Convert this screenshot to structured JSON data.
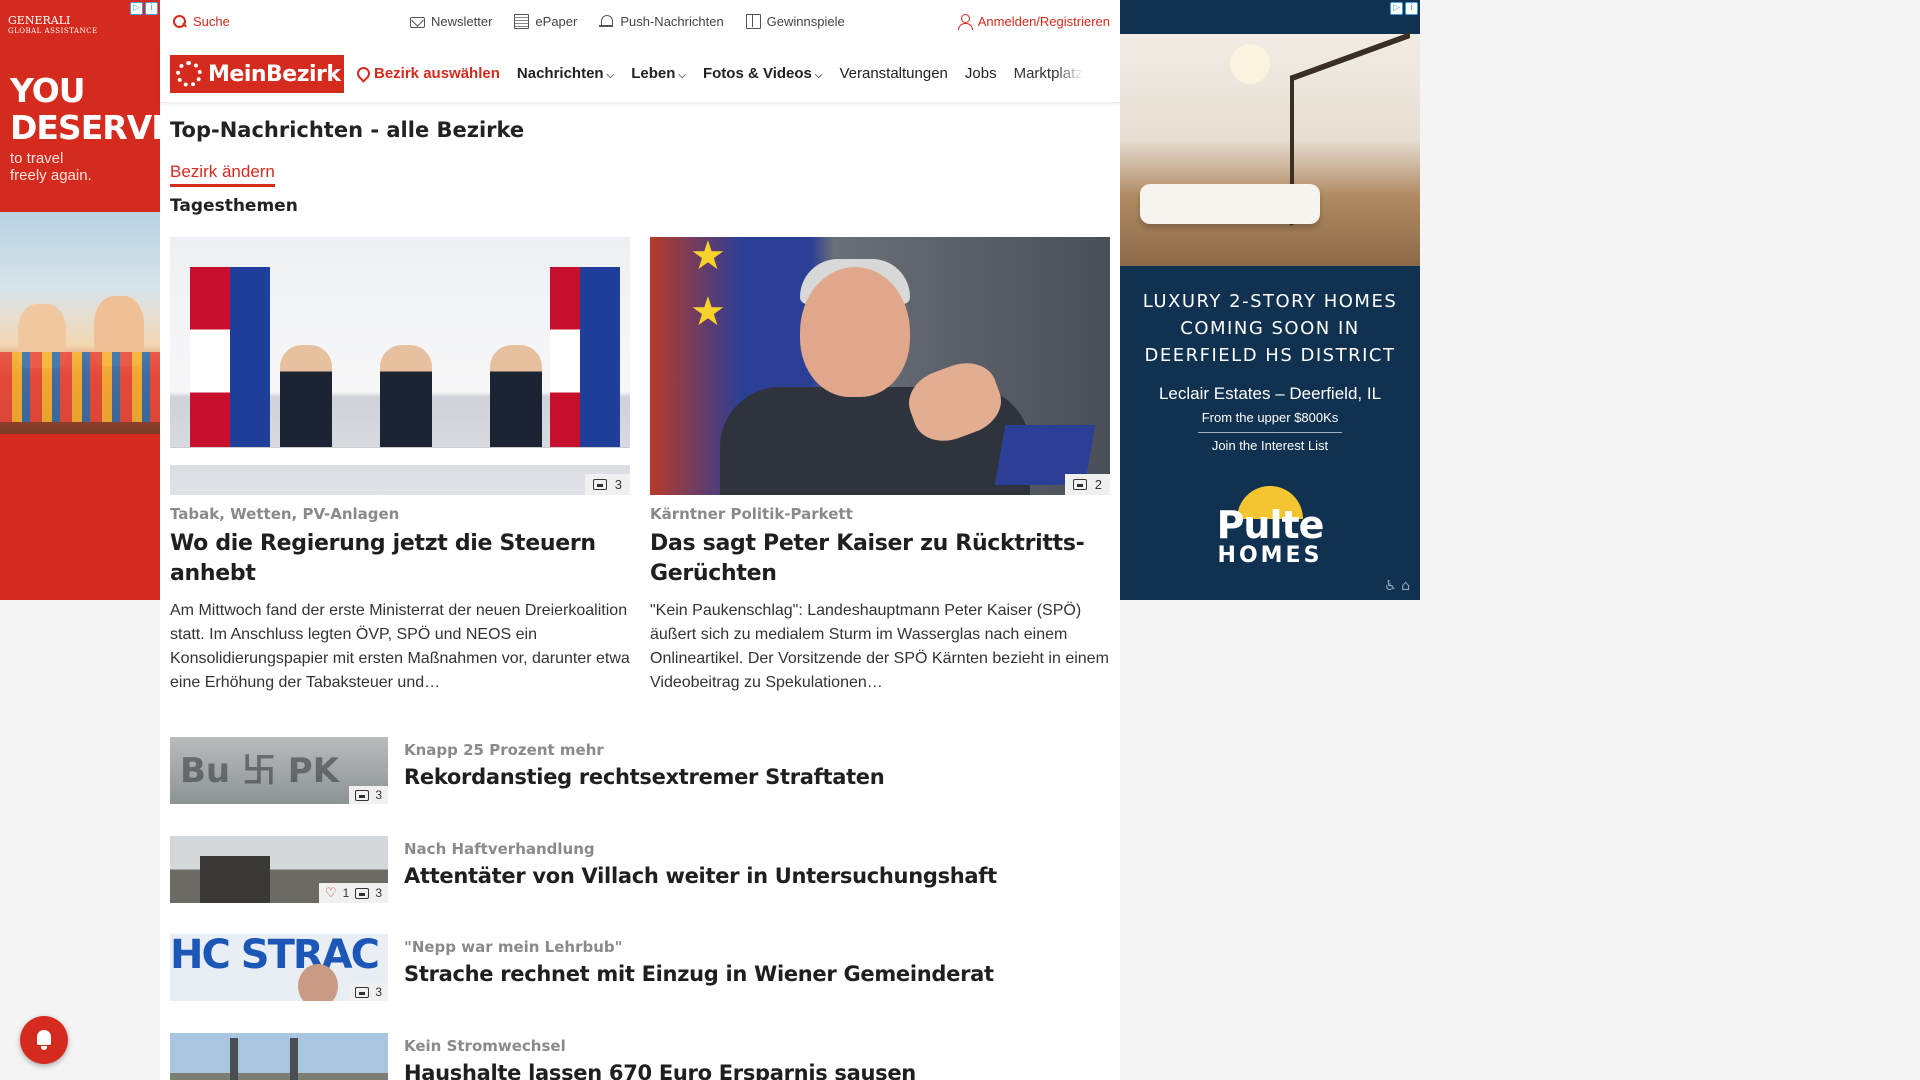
{
  "ads": {
    "left": {
      "brand": "GENERALI",
      "brand_sub": "GLOBAL ASSISTANCE",
      "headline_line1": "YOU",
      "headline_line2": "DESERVE",
      "sub_line1": "to travel",
      "sub_line2": "freely again."
    },
    "right": {
      "headline_line1": "LUXURY 2-STORY HOMES",
      "headline_line2": "COMING SOON IN",
      "headline_line3": "DEERFIELD HS DISTRICT",
      "community": "Leclair Estates – Deerfield, IL",
      "price": "From the upper $800Ks",
      "cta": "Join the Interest List",
      "logo_word1": "Pulte",
      "logo_word2": "HOMES"
    }
  },
  "utility": {
    "search": "Suche",
    "newsletter": "Newsletter",
    "epaper": "ePaper",
    "push": "Push-Nachrichten",
    "gewinnspiele": "Gewinnspiele",
    "login": "Anmelden/Registrieren"
  },
  "nav": {
    "logo": "MeinBezirk",
    "region": "Bezirk auswählen",
    "items": [
      "Nachrichten",
      "Leben",
      "Fotos & Videos",
      "Veranstaltungen",
      "Jobs",
      "Marktplatz"
    ]
  },
  "page": {
    "title": "Top-Nachrichten - alle Bezirke",
    "change_district": "Bezirk ändern",
    "section": "Tagesthemen"
  },
  "featured": [
    {
      "kicker": "Tabak, Wetten, PV-Anlagen",
      "headline": "Wo die Regierung jetzt die Steuern anhebt",
      "teaser": "Am Mittwoch fand der erste Ministerrat der neuen Dreierkoalition statt. Im Anschluss legten ÖVP, SPÖ und NEOS ein Konsolidierungspapier mit ersten Maßnahmen vor, darunter etwa eine Erhöhung der Tabaksteuer und…",
      "photos": "3"
    },
    {
      "kicker": "Kärntner Politik-Parkett",
      "headline": "Das sagt Peter Kaiser zu Rücktritts-Gerüchten",
      "teaser": "\"Kein Paukenschlag\": Landeshauptmann Peter Kaiser (SPÖ) äußert sich zu medialem Sturm im Wasserglas nach einem Onlineartikel. Der Vorsitzende der SPÖ Kärnten bezieht in einem Videobeitrag zu Spekulationen…",
      "photos": "2"
    }
  ],
  "list": [
    {
      "kicker": "Knapp 25 Prozent mehr",
      "headline": "Rekordanstieg rechtsextremer Straftaten",
      "photos": "3",
      "likes": ""
    },
    {
      "kicker": "Nach Haftverhandlung",
      "headline": "Attentäter von Villach weiter in Untersuchungshaft",
      "photos": "3",
      "likes": "1"
    },
    {
      "kicker": "\"Nepp war mein Lehrbub\"",
      "headline": "Strache rechnet mit Einzug in Wiener Gemeinderat",
      "photos": "3",
      "likes": ""
    },
    {
      "kicker": "Kein Stromwechsel",
      "headline": "Haushalte lassen 670 Euro Ersparnis sausen",
      "photos": "",
      "likes": ""
    }
  ]
}
